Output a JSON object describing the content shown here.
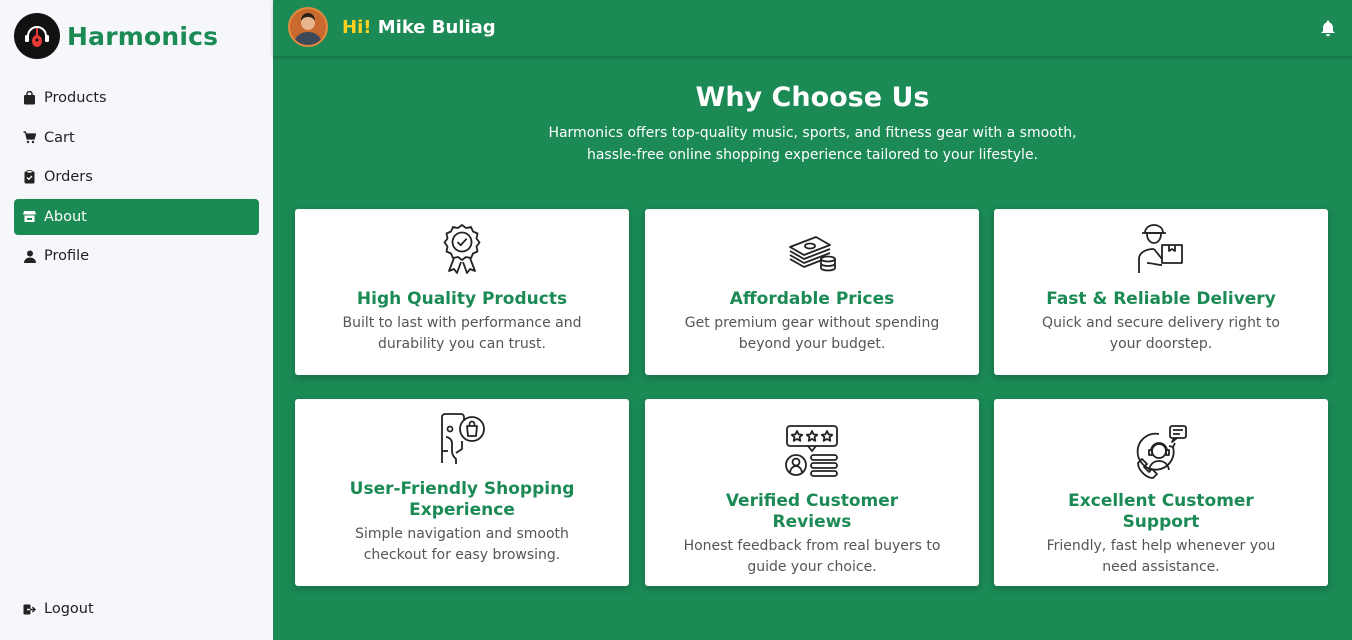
{
  "app": {
    "name": "Harmonics"
  },
  "sidebar": {
    "items": [
      {
        "label": "Products",
        "icon": "shopping-bag-icon"
      },
      {
        "label": "Cart",
        "icon": "cart-icon"
      },
      {
        "label": "Orders",
        "icon": "clipboard-icon"
      },
      {
        "label": "About",
        "icon": "store-icon",
        "active": true
      },
      {
        "label": "Profile",
        "icon": "user-icon"
      }
    ],
    "logout": "Logout"
  },
  "header": {
    "hi": "Hi!",
    "user_name": "Mike Buliag",
    "notification_icon": "bell-icon"
  },
  "about": {
    "title": "Why Choose Us",
    "subtitle_line1": "Harmonics offers top-quality music, sports, and fitness gear with a smooth,",
    "subtitle_line2": "hassle-free online shopping experience tailored to your lifestyle.",
    "features": [
      {
        "title": "High Quality Products",
        "description": "Built to last with performance and durability you can trust.",
        "icon": "award-badge-icon"
      },
      {
        "title": "Affordable Prices",
        "description": "Get premium gear without spending beyond your budget.",
        "icon": "money-stack-icon"
      },
      {
        "title": "Fast & Reliable Delivery",
        "description": "Quick and secure delivery right to your doorstep.",
        "icon": "delivery-person-icon"
      },
      {
        "title": "User-Friendly Shopping Experience",
        "description": "Simple navigation and smooth checkout for easy browsing.",
        "icon": "mobile-shopping-icon"
      },
      {
        "title": "Verified Customer Reviews",
        "description": "Honest feedback from real buyers to guide your choice.",
        "icon": "rating-review-icon"
      },
      {
        "title": "Excellent Customer Support",
        "description": "Friendly, fast help whenever you need assistance.",
        "icon": "customer-support-icon"
      }
    ]
  },
  "colors": {
    "primary": "#1b8a55",
    "accent": "#ffd21f",
    "sidebar_bg": "#f6f7fb"
  }
}
